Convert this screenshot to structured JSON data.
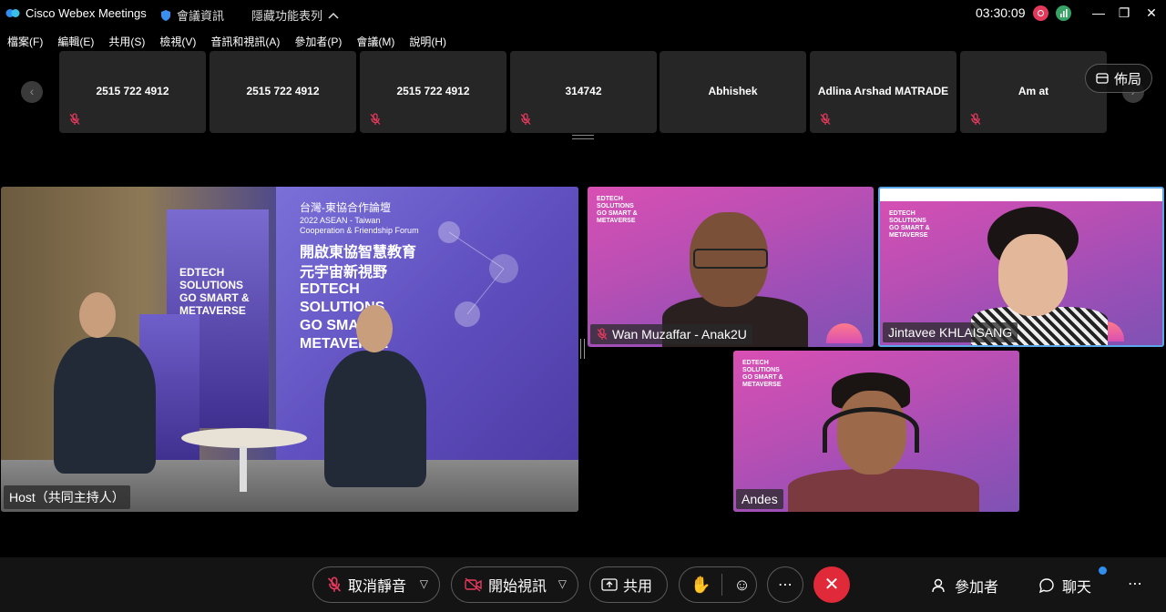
{
  "titlebar": {
    "app_title": "Cisco Webex Meetings",
    "meeting_info": "會議資訊",
    "hide_features": "隱藏功能表列",
    "clock": "03:30:09"
  },
  "menu": [
    "檔案(F)",
    "編輯(E)",
    "共用(S)",
    "檢視(V)",
    "音訊和視訊(A)",
    "參加者(P)",
    "會議(M)",
    "說明(H)"
  ],
  "strip": {
    "participants": [
      {
        "name": "2515 722 4912",
        "muted": true
      },
      {
        "name": "2515 722 4912",
        "muted": false
      },
      {
        "name": "2515 722 4912",
        "muted": true
      },
      {
        "name": "314742",
        "muted": true
      },
      {
        "name": "Abhishek",
        "muted": false
      },
      {
        "name": "Adlina Arshad MATRADE",
        "muted": true
      },
      {
        "name": "Am at",
        "muted": true
      }
    ],
    "layout_label": "佈局"
  },
  "videos": {
    "host": {
      "label": "Host（共同主持人）"
    },
    "v1": {
      "label": "Wan Muzaffar - Anak2U",
      "muted": true
    },
    "v2": {
      "label": "Jintavee KHLAISANG",
      "muted": false
    },
    "v3": {
      "label": "Andes",
      "muted": false
    },
    "backdrop_text": [
      "EDTECH",
      "SOLUTIONS",
      "GO SMART &",
      "METAVERSE"
    ]
  },
  "stage_text": {
    "line1": "台灣-東協合作論壇",
    "line2": "2022 ASEAN - Taiwan",
    "line3": "Cooperation & Friendship Forum",
    "line4": "開啟東協智慧教育",
    "line5": "元宇宙新視野",
    "line6": "EDTECH",
    "line7": "SOLUTIONS",
    "line8": "GO SMART &",
    "line9": "METAVERSE",
    "banner1": "EDTECH",
    "banner2": "SOLUTIONS",
    "banner3": "GO SMART &",
    "banner4": "METAVERSE"
  },
  "controls": {
    "unmute": "取消靜音",
    "start_video": "開始視訊",
    "share": "共用",
    "participants": "參加者",
    "chat": "聊天"
  },
  "colors": {
    "end_call": "#e02939",
    "active_speaker_border": "#59a6e8",
    "mute_icon": "#e5395c"
  }
}
